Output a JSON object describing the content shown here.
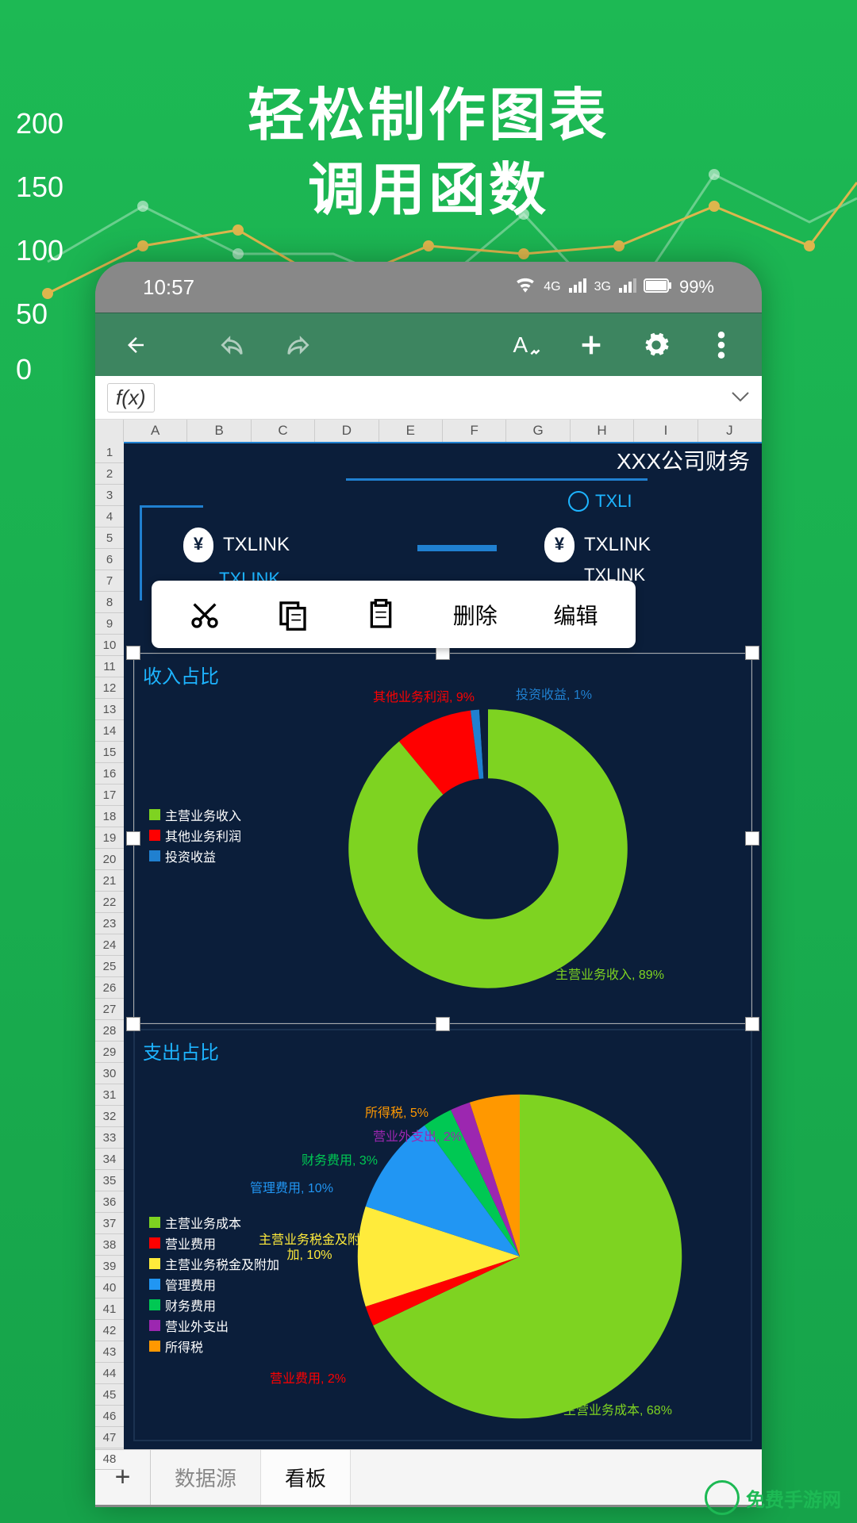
{
  "promo": {
    "line1": "轻松制作图表",
    "line2": "调用函数"
  },
  "bg_axis": [
    "200",
    "150",
    "100",
    "50",
    "0"
  ],
  "status": {
    "time": "10:57",
    "battery": "99%",
    "net1": "4G",
    "net2": "3G"
  },
  "formula_bar": {
    "fx": "f(x)"
  },
  "columns": [
    "A",
    "B",
    "C",
    "D",
    "E",
    "F",
    "G",
    "H",
    "I",
    "J"
  ],
  "rows_visible_start": 1,
  "doc": {
    "title": "XXX公司财务",
    "txlink_top_right": "TXLI",
    "stat1": "TXLINK",
    "stat2": "TXLINK",
    "txlink_sub1": "TXLINK",
    "txlink_sub2": "TXLINK"
  },
  "context_menu": {
    "delete": "删除",
    "edit": "编辑"
  },
  "panel1": {
    "title": "收入占比"
  },
  "panel2": {
    "title": "支出占比"
  },
  "chart_data": [
    {
      "type": "pie",
      "title": "收入占比",
      "series": [
        {
          "name": "占比",
          "values": [
            89,
            9,
            1,
            1
          ]
        }
      ],
      "categories": [
        "主营业务收入",
        "其他业务利润",
        "投资收益",
        "(空)"
      ],
      "colors": [
        "#7ed321",
        "#ff0000",
        "#2080d0",
        "#0b1e3a"
      ],
      "labels": [
        {
          "text": "主营业务收入, 89%",
          "color": "#7ed321"
        },
        {
          "text": "其他业务利润, 9%",
          "color": "#ff0000"
        },
        {
          "text": "投资收益, 1%",
          "color": "#2080d0"
        }
      ],
      "legend": [
        "主营业务收入",
        "其他业务利润",
        "投资收益"
      ]
    },
    {
      "type": "pie",
      "title": "支出占比",
      "series": [
        {
          "name": "占比",
          "values": [
            68,
            2,
            10,
            10,
            3,
            2,
            5
          ]
        }
      ],
      "categories": [
        "主营业务成本",
        "营业费用",
        "主营业务税金及附加",
        "管理费用",
        "财务费用",
        "营业外支出",
        "所得税"
      ],
      "colors": [
        "#7ed321",
        "#ff0000",
        "#ffeb3b",
        "#2196f3",
        "#00c853",
        "#9c27b0",
        "#ff9800"
      ],
      "labels": [
        {
          "text": "主营业务成本, 68%",
          "color": "#7ed321"
        },
        {
          "text": "营业费用, 2%",
          "color": "#ff0000"
        },
        {
          "text": "主营业务税金及附加, 10%",
          "color": "#ffeb3b"
        },
        {
          "text": "管理费用, 10%",
          "color": "#2196f3"
        },
        {
          "text": "财务费用, 3%",
          "color": "#00c853"
        },
        {
          "text": "营业外支出, 2%",
          "color": "#9c27b0"
        },
        {
          "text": "所得税, 5%",
          "color": "#ff9800"
        }
      ],
      "legend": [
        "主营业务成本",
        "营业费用",
        "主营业务税金及附加",
        "管理费用",
        "财务费用",
        "营业外支出",
        "所得税"
      ]
    }
  ],
  "sheets": {
    "tab1": "数据源",
    "tab2": "看板"
  },
  "watermark": "免费手游网"
}
